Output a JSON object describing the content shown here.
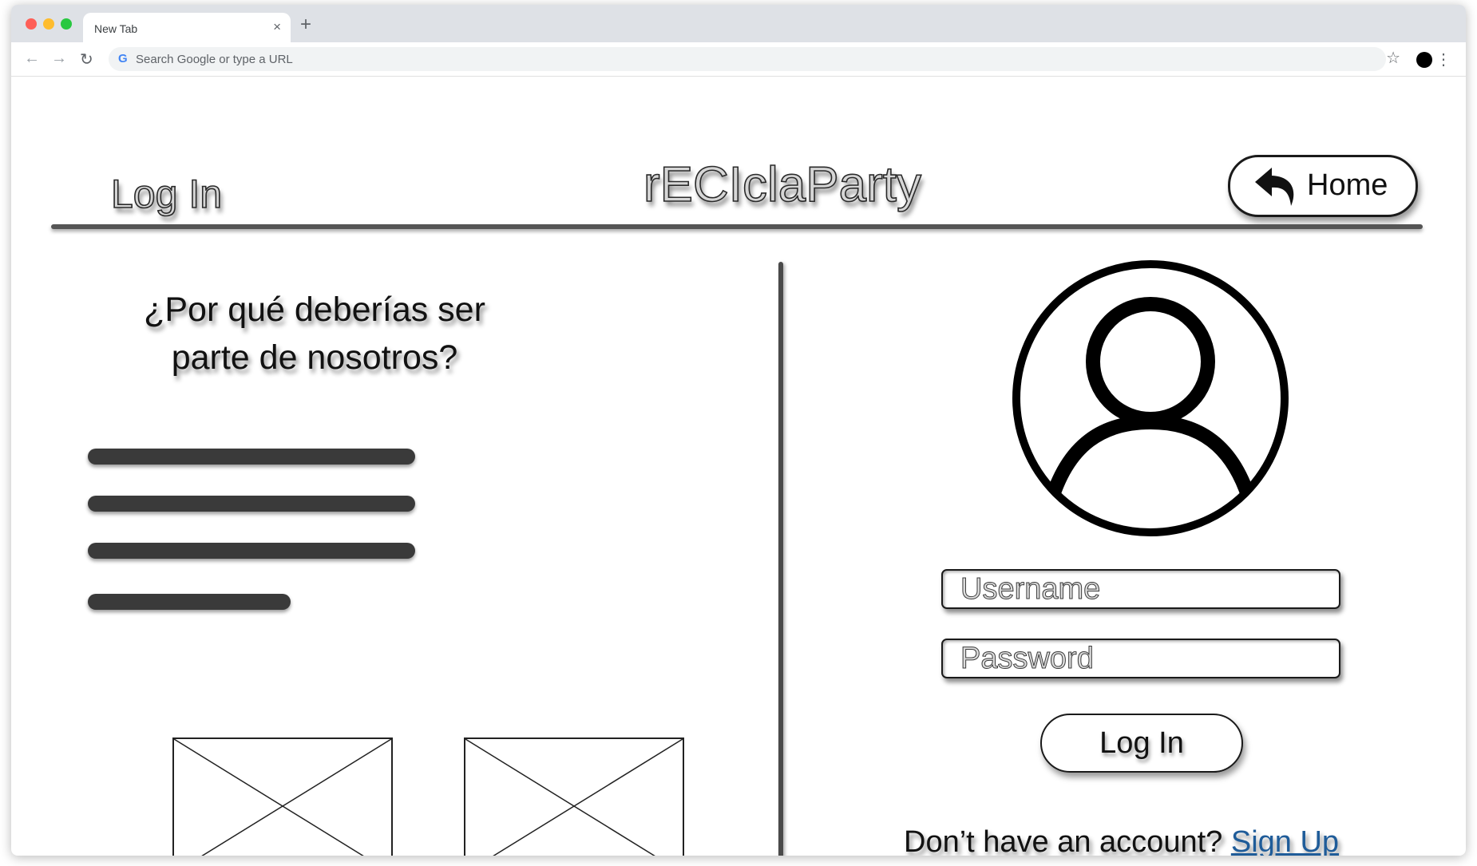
{
  "browser": {
    "tab_title": "New Tab",
    "tab_close": "×",
    "new_tab": "+",
    "omnibox_placeholder": "Search Google or type a URL",
    "nav_back": "←",
    "nav_forward": "→",
    "nav_reload": "↻",
    "star": "☆",
    "menu": "⋮",
    "google_g": "G"
  },
  "header": {
    "page_heading": "Log In",
    "brand": "rECIclaParty",
    "home_button": "Home"
  },
  "left_panel": {
    "pitch_line1": "¿Por qué deberías ser",
    "pitch_line2": "parte de nosotros?"
  },
  "login_form": {
    "username_placeholder": "Username",
    "password_placeholder": "Password",
    "submit_label": "Log In",
    "signup_prompt": "Don’t have an account? ",
    "signup_link": "Sign Up"
  },
  "icons": {
    "home": "undo-arrow-icon",
    "avatar": "user-avatar-icon",
    "placeholder": "image-placeholder-icon"
  },
  "colors": {
    "link": "#1f5c99",
    "dot_red": "#fe5f57",
    "dot_yellow": "#febc2e",
    "dot_green": "#28c840"
  }
}
